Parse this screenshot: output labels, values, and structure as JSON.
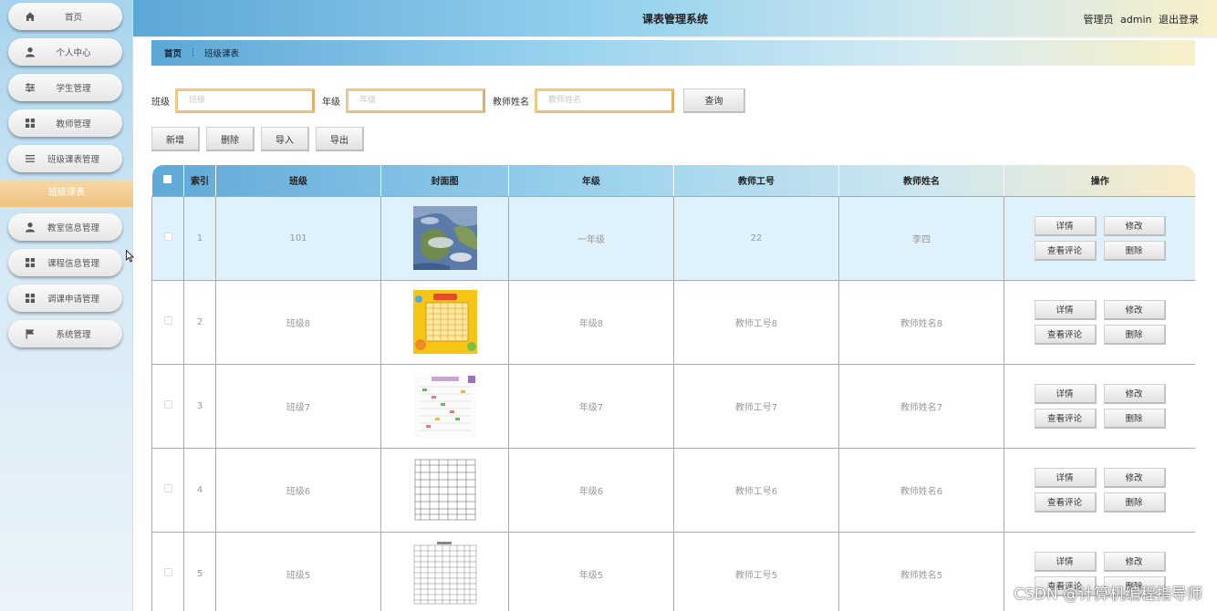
{
  "app": {
    "title": "课表管理系统",
    "user_role": "管理员",
    "username": "admin",
    "logout": "退出登录"
  },
  "sidebar": {
    "items": [
      {
        "label": "首页",
        "icon": "home-icon"
      },
      {
        "label": "个人中心",
        "icon": "person-icon"
      },
      {
        "label": "学生管理",
        "icon": "sliders-icon"
      },
      {
        "label": "教师管理",
        "icon": "grid-icon"
      },
      {
        "label": "班级课表管理",
        "icon": "list-icon"
      },
      {
        "label": "教室信息管理",
        "icon": "person-icon"
      },
      {
        "label": "课程信息管理",
        "icon": "grid-icon"
      },
      {
        "label": "调课申请管理",
        "icon": "grid-icon"
      },
      {
        "label": "系统管理",
        "icon": "flag-icon"
      }
    ],
    "active_sub": "班级课表"
  },
  "breadcrumb": {
    "home": "首页",
    "current": "班级课表"
  },
  "search": {
    "class_label": "班级",
    "class_placeholder": "班级",
    "grade_label": "年级",
    "grade_placeholder": "年级",
    "teacher_label": "教师姓名",
    "teacher_placeholder": "教师姓名",
    "query": "查询"
  },
  "actions": {
    "add": "新增",
    "delete": "删除",
    "import": "导入",
    "export": "导出"
  },
  "table": {
    "headers": [
      "索引",
      "班级",
      "封面图",
      "年级",
      "教师工号",
      "教师姓名",
      "操作"
    ],
    "row_buttons": {
      "detail": "详情",
      "edit": "修改",
      "comments": "查看评论",
      "delete": "删除"
    },
    "rows": [
      {
        "index": "1",
        "class": "101",
        "grade": "一年级",
        "teacher_id": "22",
        "teacher_name": "李四",
        "cover": "weather-map"
      },
      {
        "index": "2",
        "class": "班级8",
        "grade": "年级8",
        "teacher_id": "教师工号8",
        "teacher_name": "教师姓名8",
        "cover": "yellow-timetable"
      },
      {
        "index": "3",
        "class": "班级7",
        "grade": "年级7",
        "teacher_id": "教师工号7",
        "teacher_name": "教师姓名7",
        "cover": "colorful-timetable"
      },
      {
        "index": "4",
        "class": "班级6",
        "grade": "年级6",
        "teacher_id": "教师工号6",
        "teacher_name": "教师姓名6",
        "cover": "grid-timetable"
      },
      {
        "index": "5",
        "class": "班级5",
        "grade": "年级5",
        "teacher_id": "教师工号5",
        "teacher_name": "教师姓名5",
        "cover": "dense-timetable"
      }
    ]
  },
  "watermark": "CSDN @计算机编程指导师",
  "colors": {
    "accent_blue": "#5ba7d6",
    "accent_gold": "#f1c784",
    "row_highlight": "#dff1fb"
  }
}
